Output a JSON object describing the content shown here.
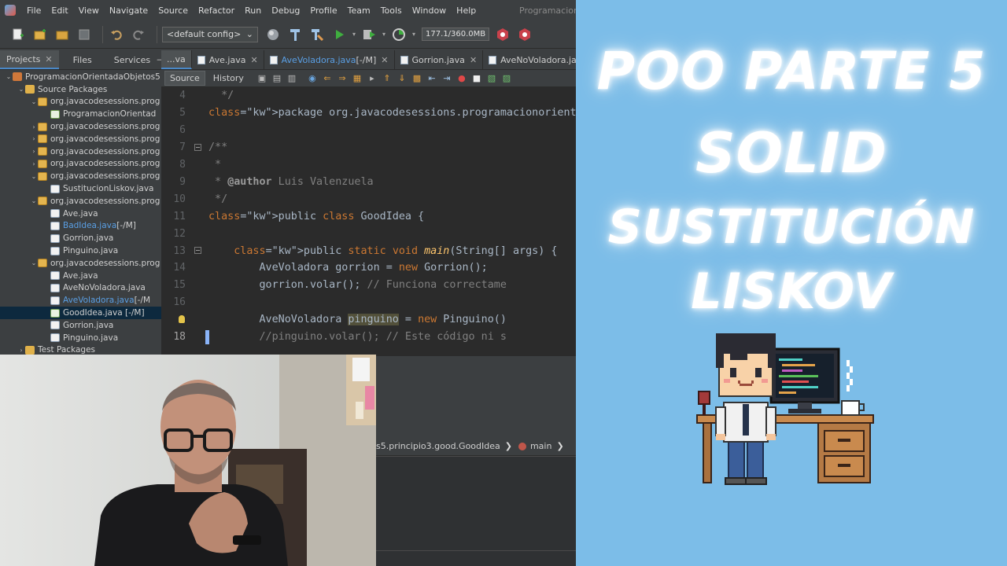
{
  "ide": {
    "window_title": "ProgramacionO",
    "menu": [
      "File",
      "Edit",
      "View",
      "Navigate",
      "Source",
      "Refactor",
      "Run",
      "Debug",
      "Profile",
      "Team",
      "Tools",
      "Window",
      "Help"
    ],
    "toolbar": {
      "config": "<default config>",
      "memory": "177.1/360.0MB"
    },
    "panel_tabs": [
      {
        "label": "Projects",
        "active": true
      },
      {
        "label": "Files",
        "active": false
      },
      {
        "label": "Services",
        "active": false
      }
    ],
    "tree": [
      {
        "label": "ProgramacionOrientadaObjetos5",
        "depth": 0,
        "icon": "project-icon",
        "arrow": "down"
      },
      {
        "label": "Source Packages",
        "depth": 1,
        "icon": "folder-icon",
        "arrow": "down"
      },
      {
        "label": "org.javacodesessions.prog",
        "depth": 2,
        "icon": "package-icon",
        "arrow": "down"
      },
      {
        "label": "ProgramacionOrientad",
        "depth": 3,
        "icon": "main-class-icon",
        "arrow": ""
      },
      {
        "label": "org.javacodesessions.prog",
        "depth": 2,
        "icon": "package-icon",
        "arrow": "right"
      },
      {
        "label": "org.javacodesessions.prog",
        "depth": 2,
        "icon": "package-icon",
        "arrow": "right"
      },
      {
        "label": "org.javacodesessions.prog",
        "depth": 2,
        "icon": "package-icon",
        "arrow": "right"
      },
      {
        "label": "org.javacodesessions.prog",
        "depth": 2,
        "icon": "package-icon",
        "arrow": "right"
      },
      {
        "label": "org.javacodesessions.prog",
        "depth": 2,
        "icon": "package-icon",
        "arrow": "down"
      },
      {
        "label": "SustitucionLiskov.java",
        "depth": 3,
        "icon": "java-file-icon",
        "arrow": ""
      },
      {
        "label": "org.javacodesessions.prog",
        "depth": 2,
        "icon": "package-icon",
        "arrow": "down"
      },
      {
        "label": "Ave.java",
        "depth": 3,
        "icon": "java-file-icon",
        "arrow": ""
      },
      {
        "label": "BadIdea.java",
        "suffix": " [-/M]",
        "depth": 3,
        "icon": "java-file-icon",
        "arrow": "",
        "modified": true
      },
      {
        "label": "Gorrion.java",
        "depth": 3,
        "icon": "java-file-icon",
        "arrow": ""
      },
      {
        "label": "Pinguino.java",
        "depth": 3,
        "icon": "java-file-icon",
        "arrow": ""
      },
      {
        "label": "org.javacodesessions.prog",
        "depth": 2,
        "icon": "package-icon",
        "arrow": "down"
      },
      {
        "label": "Ave.java",
        "depth": 3,
        "icon": "java-file-icon",
        "arrow": ""
      },
      {
        "label": "AveNoVoladora.java",
        "depth": 3,
        "icon": "java-file-icon",
        "arrow": ""
      },
      {
        "label": "AveVoladora.java",
        "suffix": " [-/M",
        "depth": 3,
        "icon": "java-file-icon",
        "arrow": "",
        "modified": true
      },
      {
        "label": "GoodIdea.java [-/M]",
        "depth": 3,
        "icon": "main-class-icon",
        "arrow": "",
        "selected": true
      },
      {
        "label": "Gorrion.java",
        "depth": 3,
        "icon": "java-file-icon",
        "arrow": ""
      },
      {
        "label": "Pinguino.java",
        "depth": 3,
        "icon": "java-file-icon",
        "arrow": ""
      },
      {
        "label": "Test Packages",
        "depth": 1,
        "icon": "folder-icon",
        "arrow": "right"
      }
    ],
    "editor_tabs": [
      {
        "label": "...va",
        "active": true,
        "close": false
      },
      {
        "label": "Ave.java",
        "active": false,
        "close": true
      },
      {
        "label": "AveVoladora.java",
        "suffix": " [-/M]",
        "active": false,
        "close": true,
        "modified": true
      },
      {
        "label": "Gorrion.java",
        "active": false,
        "close": true
      },
      {
        "label": "AveNoVoladora.java",
        "active": false,
        "close": true
      }
    ],
    "source_label": "Source",
    "history_label": "History",
    "code_lines": [
      {
        "n": "4",
        "fold": false,
        "t": "  */"
      },
      {
        "n": "5",
        "fold": false,
        "t": "package org.javacodesessions.programacionorient"
      },
      {
        "n": "6",
        "fold": false,
        "t": ""
      },
      {
        "n": "7",
        "fold": true,
        "t": "/**"
      },
      {
        "n": "8",
        "fold": false,
        "t": " *"
      },
      {
        "n": "9",
        "fold": false,
        "t": " * @author Luis Valenzuela"
      },
      {
        "n": "10",
        "fold": false,
        "t": " */"
      },
      {
        "n": "11",
        "fold": false,
        "t": "public class GoodIdea {"
      },
      {
        "n": "12",
        "fold": false,
        "t": ""
      },
      {
        "n": "13",
        "fold": true,
        "t": "    public static void main(String[] args) {"
      },
      {
        "n": "14",
        "fold": false,
        "t": "        AveVoladora gorrion = new Gorrion();"
      },
      {
        "n": "15",
        "fold": false,
        "t": "        gorrion.volar(); // Funciona correctame"
      },
      {
        "n": "16",
        "fold": false,
        "t": ""
      },
      {
        "n": "",
        "fold": false,
        "t": "        AveNoVoladora pinguino = new Pinguino()"
      },
      {
        "n": "18",
        "fold": false,
        "t": "        //pinguino.volar(); // Este código ni s"
      }
    ],
    "breadcrumb": [
      "s5.principio3.good.GoodIdea",
      "main"
    ]
  },
  "title": {
    "line1": "POO PARTE 5",
    "line2": "SOLID",
    "line3": "SUSTITUCIÓN",
    "line4": "LISKOV"
  },
  "colors": {
    "background": "#7cbde8",
    "ide_panel": "#3c3f41",
    "editor_bg": "#2b2b2b",
    "keyword": "#cc7832",
    "comment": "#808080",
    "method": "#ffc66d",
    "modified_file": "#5a9fe4"
  }
}
